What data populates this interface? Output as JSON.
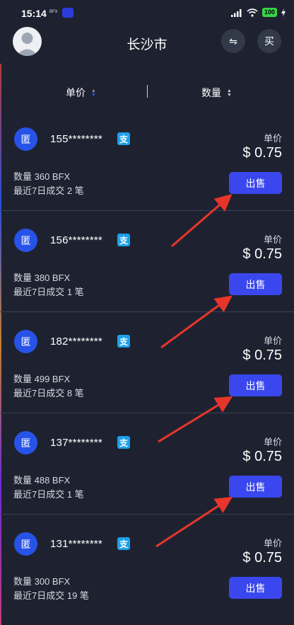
{
  "status_bar": {
    "time": "15:14",
    "mini_label": "BFX",
    "battery": "100"
  },
  "header": {
    "title": "长沙市",
    "swap_symbol": "⇋",
    "buy_label": "买"
  },
  "sort": {
    "price_label": "单价",
    "quantity_label": "数量"
  },
  "colors": {
    "background": "#1e2230",
    "accent_button": "#3a47ee",
    "merchant_icon": "#2853e8",
    "pay_icon": "#1da1ea",
    "annotation_arrow": "#e8352b"
  },
  "icons": [
    "user-avatar-icon",
    "swap-icon",
    "alipay-icon",
    "sort-arrows-icon",
    "signal-icon",
    "wifi-icon",
    "battery-icon"
  ],
  "listings": [
    {
      "icon_text": "匿",
      "phone": "155********",
      "pay_icon": "支",
      "quantity": "数量 360 BFX",
      "trades": "最近7日成交 2 笔",
      "price_label": "单价",
      "price": "$ 0.75",
      "sell_label": "出售"
    },
    {
      "icon_text": "匿",
      "phone": "156********",
      "pay_icon": "支",
      "quantity": "数量 380 BFX",
      "trades": "最近7日成交 1 笔",
      "price_label": "单价",
      "price": "$ 0.75",
      "sell_label": "出售"
    },
    {
      "icon_text": "匿",
      "phone": "182********",
      "pay_icon": "支",
      "quantity": "数量 499 BFX",
      "trades": "最近7日成交 8 笔",
      "price_label": "单价",
      "price": "$ 0.75",
      "sell_label": "出售"
    },
    {
      "icon_text": "匿",
      "phone": "137********",
      "pay_icon": "支",
      "quantity": "数量 488 BFX",
      "trades": "最近7日成交 1 笔",
      "price_label": "单价",
      "price": "$ 0.75",
      "sell_label": "出售"
    },
    {
      "icon_text": "匿",
      "phone": "131********",
      "pay_icon": "支",
      "quantity": "数量 300 BFX",
      "trades": "最近7日成交 19 笔",
      "price_label": "单价",
      "price": "$ 0.75",
      "sell_label": "出售"
    }
  ]
}
